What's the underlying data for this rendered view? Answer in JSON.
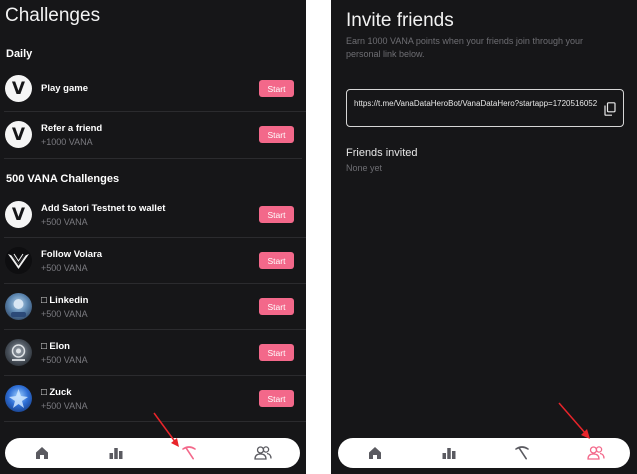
{
  "left_screen": {
    "title": "Challenges",
    "sections": {
      "daily": "Daily",
      "vana": "500 VANA Challenges"
    },
    "challenges": [
      {
        "name": "Play game",
        "reward": "",
        "avatar": "vana-logo",
        "button": "Start"
      },
      {
        "name": "Refer a friend",
        "reward": "+1000 VANA",
        "avatar": "vana-logo",
        "button": "Start"
      },
      {
        "name": "Add Satori Testnet to wallet",
        "reward": "+500 VANA",
        "avatar": "vana-logo",
        "button": "Start"
      },
      {
        "name": "Follow Volara",
        "reward": "+500 VANA",
        "avatar": "volara-logo",
        "button": "Start"
      },
      {
        "name": "□ Linkedin",
        "reward": "+500 VANA",
        "avatar": "linkedin-avatar",
        "button": "Start"
      },
      {
        "name": "□ Elon",
        "reward": "+500 VANA",
        "avatar": "elon-avatar",
        "button": "Start"
      },
      {
        "name": "□ Zuck",
        "reward": "+500 VANA",
        "avatar": "zuck-avatar",
        "button": "Start"
      }
    ],
    "nav": [
      "home-icon",
      "leaderboard-icon",
      "pickaxe-icon",
      "friends-icon"
    ],
    "active_nav": "pickaxe-icon"
  },
  "right_screen": {
    "title": "Invite friends",
    "subtitle": "Earn 1000 VANA points when your friends join through your personal link below.",
    "invite_link": "https://t.me/VanaDataHeroBot/VanaDataHero?startapp=1720516052",
    "copy_icon": "copy-icon",
    "friends_invited_label": "Friends invited",
    "friends_invited_value": "None yet",
    "nav": [
      "home-icon",
      "leaderboard-icon",
      "pickaxe-icon",
      "friends-icon"
    ],
    "active_nav": "friends-icon"
  },
  "colors": {
    "background": "#161618",
    "accent": "#f3688a",
    "muted_text": "#7b7b80",
    "annotation_arrow": "#e8242a"
  }
}
